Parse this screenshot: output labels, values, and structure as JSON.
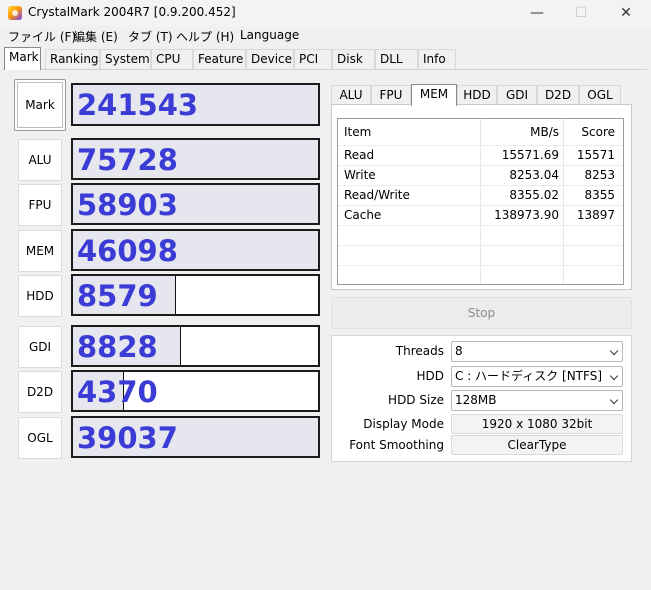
{
  "window": {
    "title": "CrystalMark 2004R7 [0.9.200.452]",
    "min": "—",
    "max": "☐",
    "close": "✕"
  },
  "menu": [
    "ファイル (F)",
    "編集 (E)",
    "タブ (T)",
    "ヘルプ (H)",
    "Language"
  ],
  "tabs": [
    "Mark",
    "Ranking",
    "System",
    "CPU",
    "Feature",
    "Device",
    "PCI",
    "Disk",
    "DLL",
    "Info"
  ],
  "active_tab": "Mark",
  "scores": [
    {
      "label": "Mark",
      "value": "241543",
      "fill": 1.0
    },
    {
      "label": "ALU",
      "value": "75728",
      "fill": 1.0
    },
    {
      "label": "FPU",
      "value": "58903",
      "fill": 1.0
    },
    {
      "label": "MEM",
      "value": "46098",
      "fill": 1.0
    },
    {
      "label": "HDD",
      "value": "8579",
      "fill": 0.42
    },
    {
      "label": "GDI",
      "value": "8828",
      "fill": 0.44
    },
    {
      "label": "D2D",
      "value": "4370",
      "fill": 0.21
    },
    {
      "label": "OGL",
      "value": "39037",
      "fill": 1.0
    }
  ],
  "subtabs": [
    "ALU",
    "FPU",
    "MEM",
    "HDD",
    "GDI",
    "D2D",
    "OGL"
  ],
  "active_subtab": "MEM",
  "table": {
    "headers": [
      "Item",
      "MB/s",
      "Score"
    ],
    "rows": [
      [
        "Read",
        "15571.69",
        "15571"
      ],
      [
        "Write",
        "8253.04",
        "8253"
      ],
      [
        "Read/Write",
        "8355.02",
        "8355"
      ],
      [
        "Cache",
        "138973.90",
        "13897"
      ]
    ]
  },
  "stop_label": "Stop",
  "settings": {
    "threads_label": "Threads",
    "threads_value": "8",
    "hdd_label": "HDD",
    "hdd_value": "C : ハードディスク [NTFS]",
    "hdd_size_label": "HDD Size",
    "hdd_size_value": "128MB",
    "display_mode_label": "Display Mode",
    "display_mode_value": "1920 x 1080 32bit",
    "font_smoothing_label": "Font Smoothing",
    "font_smoothing_value": "ClearType"
  },
  "colors": {
    "score_text": "#3b3bd6",
    "bar_fill": "#e6e6ef",
    "window_bg": "#f0f0f0"
  }
}
